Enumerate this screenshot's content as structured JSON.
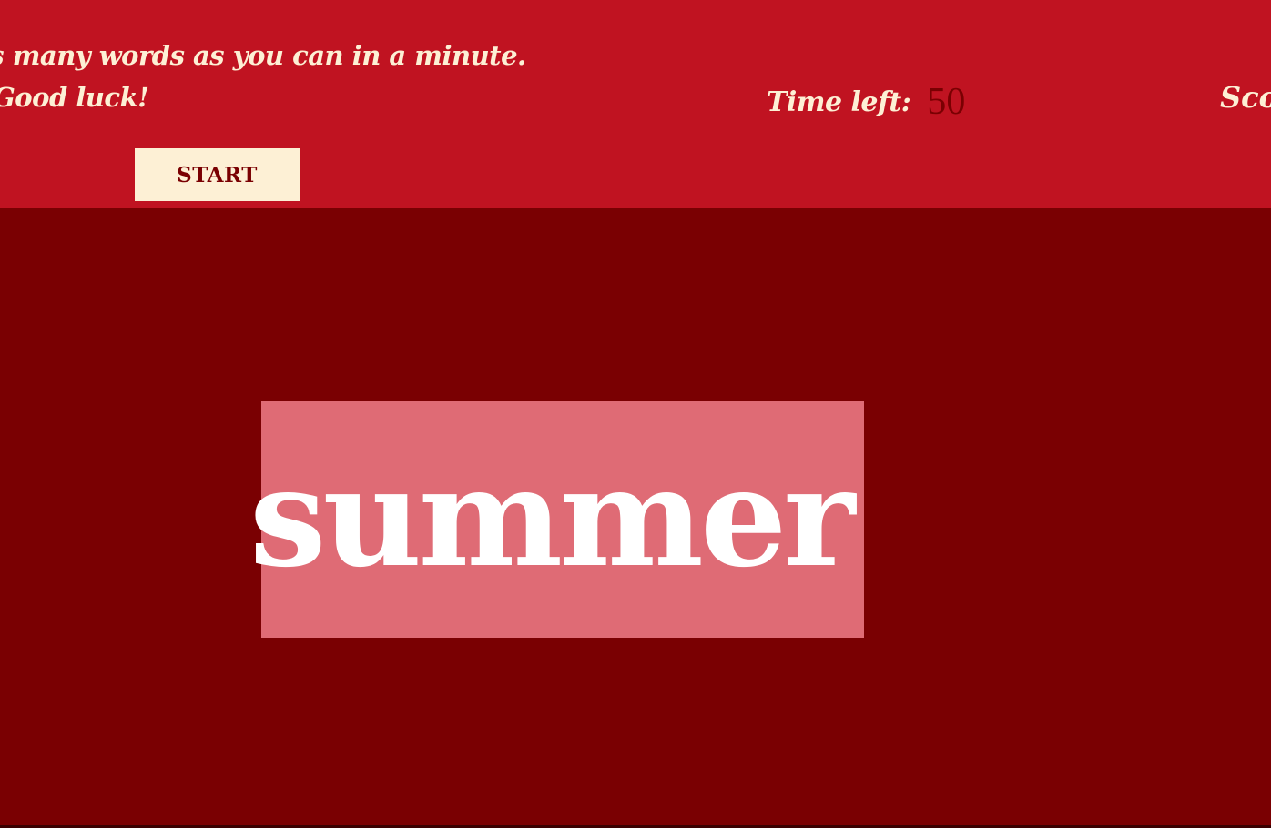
{
  "instructions": {
    "line1": "as many words as you can in a minute.",
    "line2": "Good luck!"
  },
  "timer": {
    "label": "Time left:",
    "value": "50"
  },
  "score": {
    "label": "Score:"
  },
  "start_button": {
    "label": "START"
  },
  "game": {
    "current_word": "summer"
  },
  "colors": {
    "header_bg": "#c01321",
    "main_bg": "#7a0002",
    "cream": "#fdf0d5",
    "highlight": "#df6b75",
    "word": "#ffffff"
  }
}
